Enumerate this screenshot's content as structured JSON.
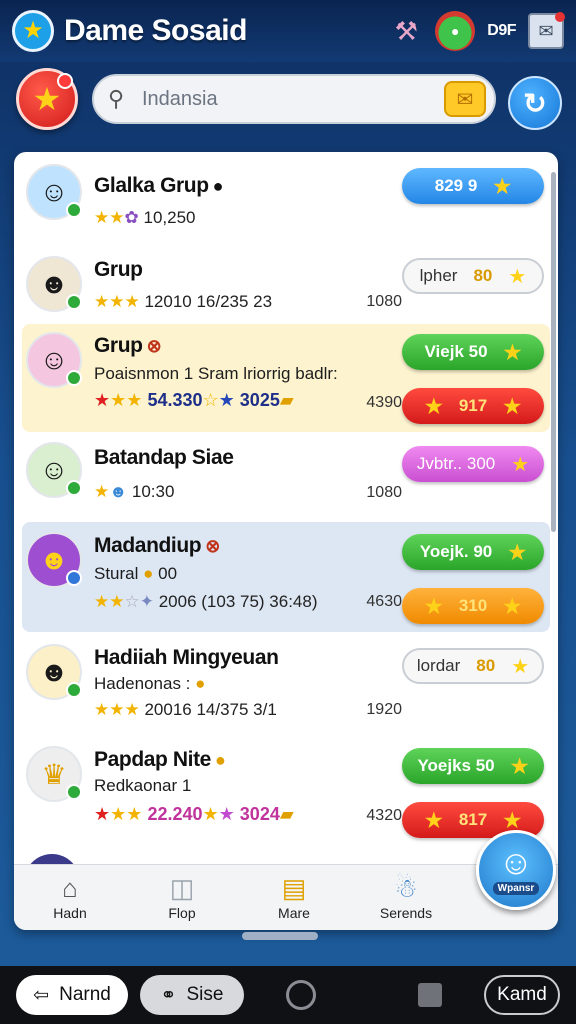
{
  "app": {
    "title": "Dame Sosaid",
    "logo_icon": "star-badge-icon",
    "top_text": "D9F"
  },
  "search": {
    "placeholder": "Indansia"
  },
  "groups": [
    {
      "title": "Glalka Grup",
      "stars_text": "10,250",
      "number": "",
      "avatar_icon": "boy-avatar-icon",
      "buttons": [
        {
          "label": "829 9",
          "style": "blue"
        }
      ]
    },
    {
      "title": "Grup",
      "stars_text": "12010 16/235 23",
      "number": "1080",
      "avatar_icon": "cat-avatar-icon",
      "buttons": [
        {
          "label": "lpher",
          "value": "80",
          "style": "white"
        }
      ]
    },
    {
      "title": "Grup",
      "subtitle": "Poaisnmon 1 Sram lriorrig badlr:",
      "stars_text_a": "54.330",
      "stars_text_b": "3025",
      "number": "4390",
      "avatar_icon": "kids-avatar-icon",
      "buttons": [
        {
          "label": "Viejk 50",
          "style": "green"
        },
        {
          "label": "917",
          "style": "red"
        }
      ]
    },
    {
      "title": "Batandap Siae",
      "stars_text": "10:30",
      "number": "1080",
      "avatar_icon": "boy-avatar-icon",
      "buttons": [
        {
          "label": "Jvbtr.. 300",
          "style": "pink"
        }
      ]
    },
    {
      "title": "Madandiup",
      "subtitle": "Stural",
      "subtitle_value": "00",
      "stars_text": "2006 (103 75)  36:48)",
      "number": "4630",
      "avatar_icon": "cat-avatar-icon",
      "buttons": [
        {
          "label": "Yoejk. 90",
          "style": "green"
        },
        {
          "label": "310",
          "style": "orange"
        }
      ]
    },
    {
      "title": "Hadiiah Mingyeuan",
      "subtitle": "Hadenonas :",
      "stars_text": "20016 14/375 3/1",
      "number": "1920",
      "avatar_icon": "cat-avatar-icon",
      "buttons": [
        {
          "label": "lordar",
          "value": "80",
          "style": "white"
        }
      ]
    },
    {
      "title": "Papdap Nite",
      "subtitle": "Redkaonar 1",
      "stars_text_a": "22.240",
      "stars_text_b": "3024",
      "number": "4320",
      "avatar_icon": "chef-hat-avatar-icon",
      "buttons": [
        {
          "label": "Yoejks 50",
          "style": "green"
        },
        {
          "label": "817",
          "style": "red"
        }
      ]
    }
  ],
  "tabs": [
    {
      "label": "Hadn",
      "icon": "home-icon"
    },
    {
      "label": "Flop",
      "icon": "cup-icon"
    },
    {
      "label": "Mare",
      "icon": "folder-icon"
    },
    {
      "label": "Serends",
      "icon": "friends-icon"
    }
  ],
  "profile_fab": {
    "label": "Wpansr"
  },
  "system_nav": {
    "back_label": "Narnd",
    "side_label": "Sise",
    "right_label": "Kamd"
  }
}
